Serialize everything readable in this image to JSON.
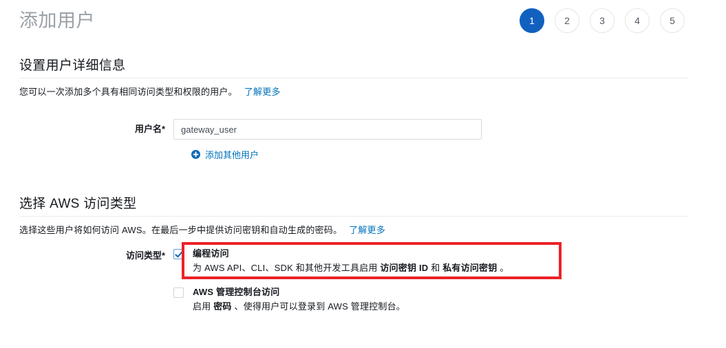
{
  "header": {
    "title": "添加用户"
  },
  "steps": {
    "current": 1,
    "items": [
      "1",
      "2",
      "3",
      "4",
      "5"
    ]
  },
  "details_section": {
    "title": "设置用户详细信息",
    "description": "您可以一次添加多个具有相同访问类型和权限的用户。",
    "learn_more": "了解更多",
    "username_label": "用户名*",
    "username_value": "gateway_user",
    "username_placeholder": "",
    "add_another_label": "添加其他用户",
    "add_another_icon": "plus-circle-icon"
  },
  "access_section": {
    "title": "选择 AWS 访问类型",
    "description": "选择这些用户将如何访问 AWS。在最后一步中提供访问密钥和自动生成的密码。",
    "learn_more": "了解更多",
    "access_type_label": "访问类型*",
    "options": [
      {
        "id": "programmatic-access",
        "checked": true,
        "title": "编程访问",
        "desc_prefix": "为 AWS API、CLI、SDK 和其他开发工具启用 ",
        "desc_bold_1": "访问密钥 ID",
        "desc_middle": " 和 ",
        "desc_bold_2": "私有访问密钥",
        "desc_suffix": " 。"
      },
      {
        "id": "console-access",
        "checked": false,
        "title": "AWS 管理控制台访问",
        "desc_prefix": "启用 ",
        "desc_bold_1": "密码",
        "desc_middle": " 、使得用户可以登录到 AWS 管理控制台。",
        "desc_bold_2": "",
        "desc_suffix": ""
      }
    ]
  },
  "colors": {
    "accent_blue": "#1160bf",
    "link_blue": "#0073bb",
    "highlight_red": "#ec2227",
    "title_gray": "#9aa0a6"
  }
}
